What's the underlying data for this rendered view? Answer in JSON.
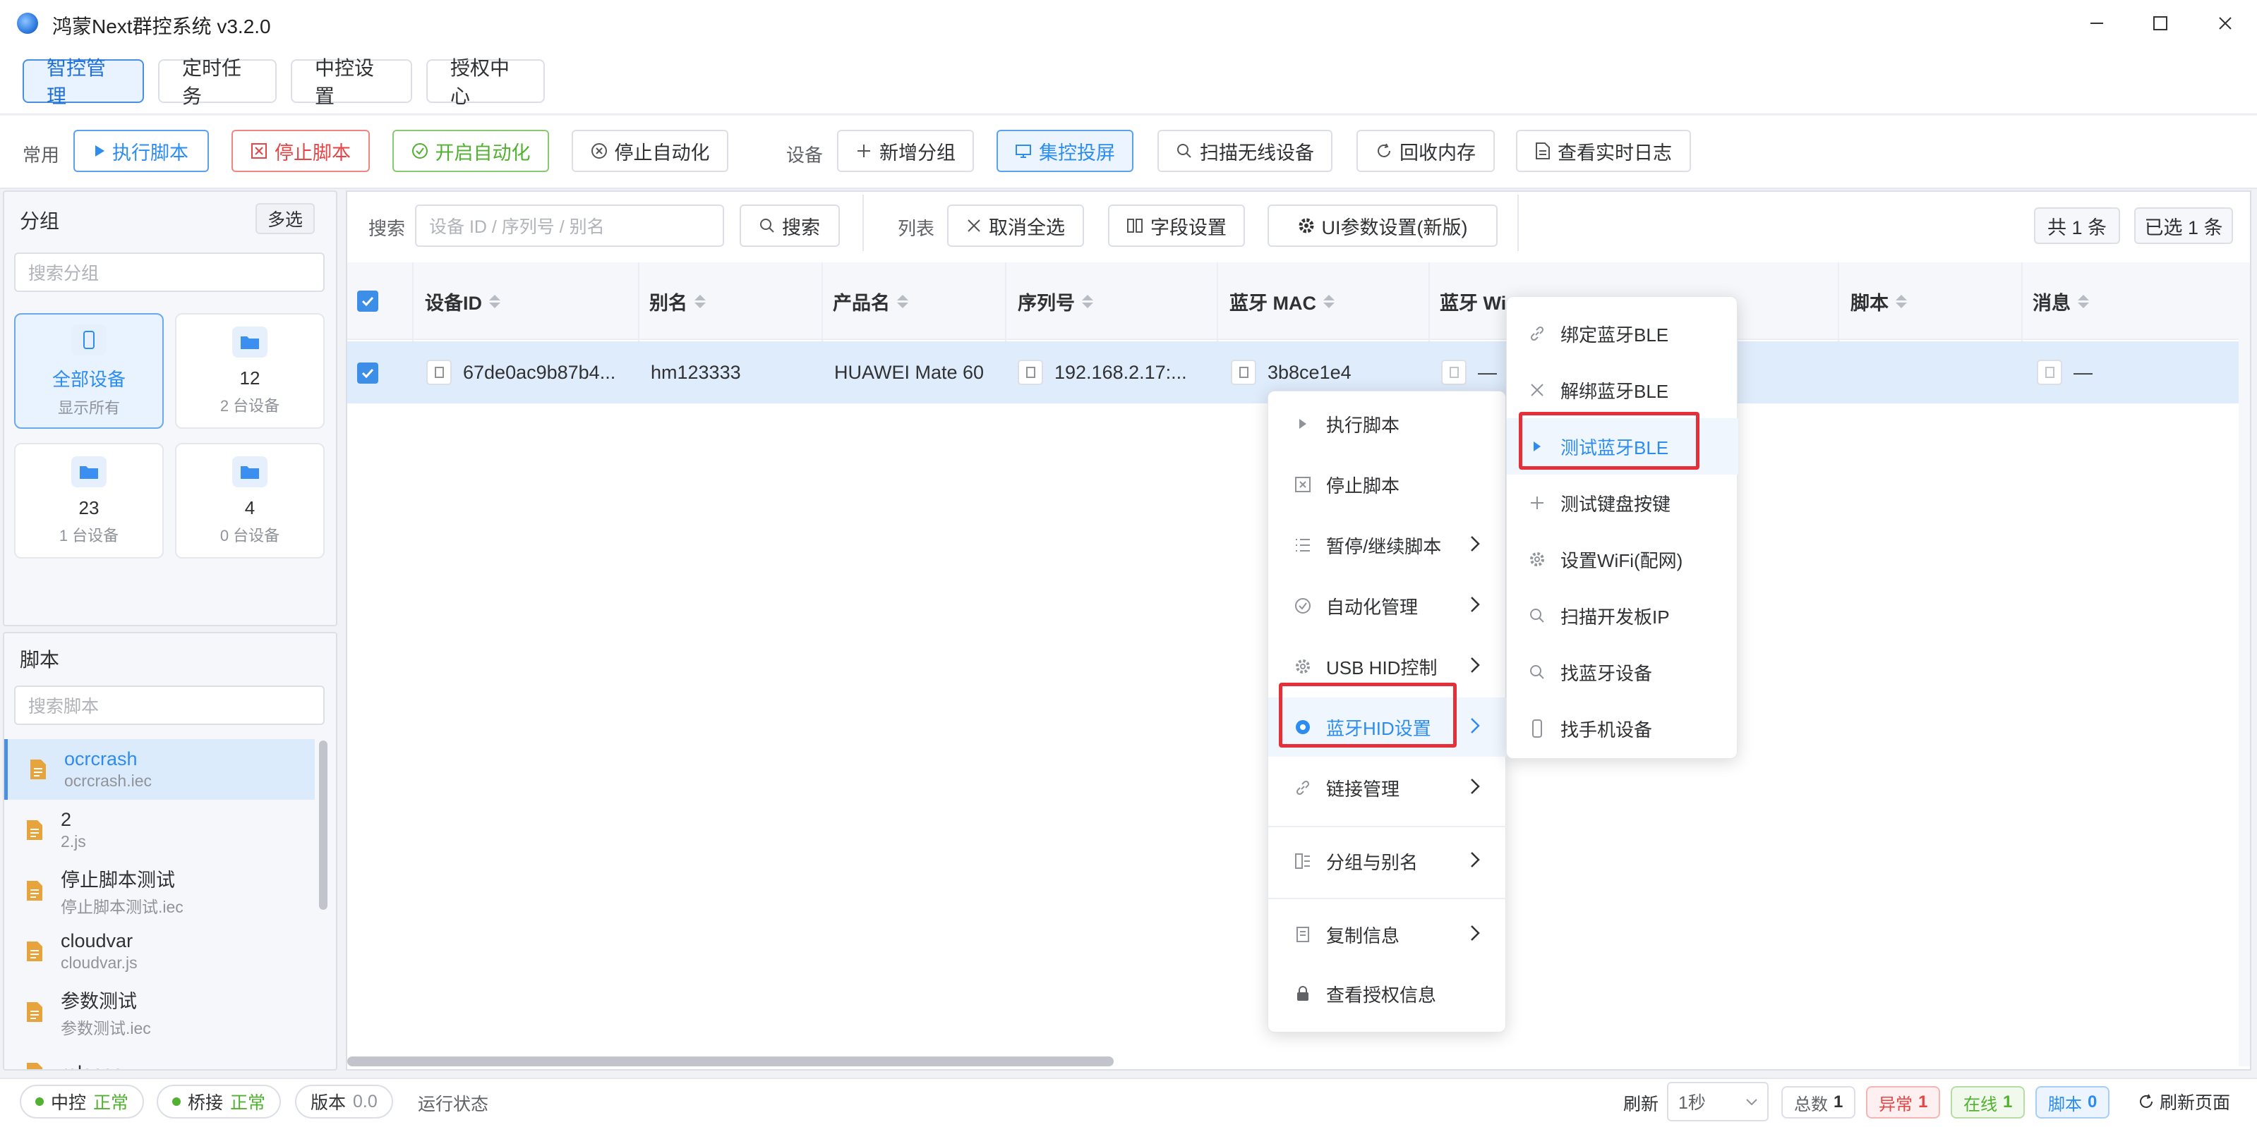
{
  "window": {
    "title": "鸿蒙Next群控系统 v3.2.0"
  },
  "top_tabs": [
    "智控管理",
    "定时任务",
    "中控设置",
    "授权中心"
  ],
  "toolbar": {
    "common_label": "常用",
    "execute": "执行脚本",
    "stop": "停止脚本",
    "auto_on": "开启自动化",
    "auto_off": "停止自动化",
    "device_label": "设备",
    "add_group": "新增分组",
    "cast": "集控投屏",
    "scan_wireless": "扫描无线设备",
    "reclaim_memory": "回收内存",
    "realtime_log": "查看实时日志"
  },
  "groups_panel": {
    "title": "分组",
    "multi_select": "多选",
    "search_placeholder": "搜索分组",
    "cards": [
      {
        "name": "全部设备",
        "sub": "显示所有",
        "icon": "phone-icon"
      },
      {
        "name": "12",
        "sub": "2 台设备",
        "icon": "folder-icon"
      },
      {
        "name": "23",
        "sub": "1 台设备",
        "icon": "folder-icon"
      },
      {
        "name": "4",
        "sub": "0 台设备",
        "icon": "folder-icon"
      }
    ]
  },
  "scripts_panel": {
    "title": "脚本",
    "search_placeholder": "搜索脚本",
    "items": [
      {
        "name": "ocrcrash",
        "file": "ocrcrash.iec"
      },
      {
        "name": "2",
        "file": "2.js"
      },
      {
        "name": "停止脚本测试",
        "file": "停止脚本测试.iec"
      },
      {
        "name": "cloudvar",
        "file": "cloudvar.js"
      },
      {
        "name": "参数测试",
        "file": "参数测试.iec"
      },
      {
        "name": "release",
        "file": ""
      }
    ]
  },
  "list_toolbar": {
    "search_label": "搜索",
    "search_placeholder": "设备 ID / 序列号 / 别名",
    "search_button": "搜索",
    "list_label": "列表",
    "deselect_all": "取消全选",
    "field_settings": "字段设置",
    "ui_params": "UI参数设置(新版)",
    "total": "共 1 条",
    "selected": "已选 1 条"
  },
  "table": {
    "columns": [
      "设备ID",
      "别名",
      "产品名",
      "序列号",
      "蓝牙 MAC",
      "蓝牙 Wi",
      "",
      "脚本",
      "消息"
    ],
    "rows": [
      {
        "device_id": "67de0ac9b87b4...",
        "alias": "hm123333",
        "product": "HUAWEI Mate 60",
        "serial": "192.168.2.17:...",
        "bt_mac": "3b8ce1e4",
        "bt_wifi": "—",
        "message": "—"
      }
    ]
  },
  "context_menu": {
    "items": [
      {
        "label": "执行脚本",
        "icon": "play-icon",
        "submenu": false
      },
      {
        "label": "停止脚本",
        "icon": "stop-box-icon",
        "submenu": false
      },
      {
        "label": "暂停/继续脚本",
        "icon": "list-icon",
        "submenu": true
      },
      {
        "label": "自动化管理",
        "icon": "check-circle-icon",
        "submenu": true
      },
      {
        "label": "USB HID控制",
        "icon": "gear-icon",
        "submenu": true
      },
      {
        "label": "蓝牙HID设置",
        "icon": "radio-icon",
        "submenu": true
      },
      {
        "label": "链接管理",
        "icon": "link-icon",
        "submenu": true
      },
      {
        "label": "分组与别名",
        "icon": "group-icon",
        "submenu": true
      },
      {
        "label": "复制信息",
        "icon": "copy-icon",
        "submenu": true
      },
      {
        "label": "查看授权信息",
        "icon": "lock-icon",
        "submenu": false
      }
    ]
  },
  "submenu": {
    "items": [
      {
        "label": "绑定蓝牙BLE",
        "icon": "link-icon"
      },
      {
        "label": "解绑蓝牙BLE",
        "icon": "close-icon"
      },
      {
        "label": "测试蓝牙BLE",
        "icon": "play-icon"
      },
      {
        "label": "测试键盘按键",
        "icon": "plus-icon"
      },
      {
        "label": "设置WiFi(配网)",
        "icon": "gear-icon"
      },
      {
        "label": "扫描开发板IP",
        "icon": "search-icon"
      },
      {
        "label": "找蓝牙设备",
        "icon": "search-icon"
      },
      {
        "label": "找手机设备",
        "icon": "phone-icon"
      }
    ]
  },
  "statusbar": {
    "center_label": "中控",
    "center_status": "正常",
    "bridge_label": "桥接",
    "bridge_status": "正常",
    "version_label": "版本",
    "version_value": "0.0",
    "run_state": "运行状态",
    "refresh_label": "刷新",
    "refresh_interval": "1秒",
    "total_label": "总数",
    "total_value": "1",
    "error_label": "异常",
    "error_value": "1",
    "online_label": "在线",
    "online_value": "1",
    "script_label": "脚本",
    "script_value": "0",
    "refresh_page": "刷新页面"
  }
}
